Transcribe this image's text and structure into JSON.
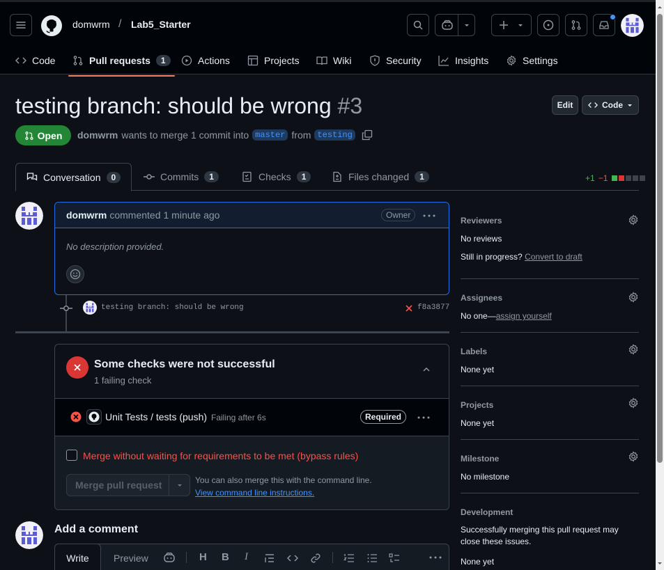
{
  "repo": {
    "owner": "domwrm",
    "separator": "/",
    "name": "Lab5_Starter"
  },
  "nav_tabs": [
    {
      "label": "Code",
      "icon": "code-icon"
    },
    {
      "label": "Pull requests",
      "icon": "pull-request-icon",
      "count": "1"
    },
    {
      "label": "Actions",
      "icon": "play-icon"
    },
    {
      "label": "Projects",
      "icon": "table-icon"
    },
    {
      "label": "Wiki",
      "icon": "book-icon"
    },
    {
      "label": "Security",
      "icon": "shield-icon"
    },
    {
      "label": "Insights",
      "icon": "graph-icon"
    },
    {
      "label": "Settings",
      "icon": "gear-icon"
    }
  ],
  "pr": {
    "title": "testing branch: should be wrong",
    "number": "#3",
    "edit_label": "Edit",
    "code_label": "Code",
    "state": "Open",
    "author": "domwrm",
    "merge_text": "wants to merge 1 commit into",
    "base": "master",
    "from_text": "from",
    "head": "testing"
  },
  "pr_tabs": [
    {
      "label": "Conversation",
      "count": "0"
    },
    {
      "label": "Commits",
      "count": "1"
    },
    {
      "label": "Checks",
      "count": "1"
    },
    {
      "label": "Files changed",
      "count": "1"
    }
  ],
  "diffstat": {
    "additions": "+1",
    "deletions": "−1"
  },
  "comment": {
    "author": "domwrm",
    "action": "commented",
    "time": "1 minute ago",
    "badge": "Owner",
    "body": "No description provided."
  },
  "commit": {
    "message": "testing branch: should be wrong",
    "sha": "f8a3877"
  },
  "checks": {
    "title": "Some checks were not successful",
    "subtitle": "1 failing check",
    "row_name": "Unit Tests / tests (push)",
    "row_status": "Failing after 6s",
    "required": "Required",
    "bypass_label": "Merge without waiting for requirements to be met (bypass rules)",
    "merge_button": "Merge pull request",
    "cli_text": "You can also merge this with the command line.",
    "cli_link": "View command line instructions."
  },
  "add_comment": {
    "title": "Add a comment",
    "write_tab": "Write",
    "preview_tab": "Preview"
  },
  "sidebar": {
    "reviewers": {
      "title": "Reviewers",
      "value": "No reviews",
      "progress_text": "Still in progress?",
      "progress_link": "Convert to draft"
    },
    "assignees": {
      "title": "Assignees",
      "value": "No one—",
      "link": "assign yourself"
    },
    "labels": {
      "title": "Labels",
      "value": "None yet"
    },
    "projects": {
      "title": "Projects",
      "value": "None yet"
    },
    "milestone": {
      "title": "Milestone",
      "value": "No milestone"
    },
    "development": {
      "title": "Development",
      "value": "Successfully merging this pull request may close these issues.",
      "value2": "None yet"
    }
  },
  "colors": {
    "accent": "#4493f8",
    "open": "#238636",
    "fail": "#da3633",
    "tab_underline": "#f78166"
  }
}
